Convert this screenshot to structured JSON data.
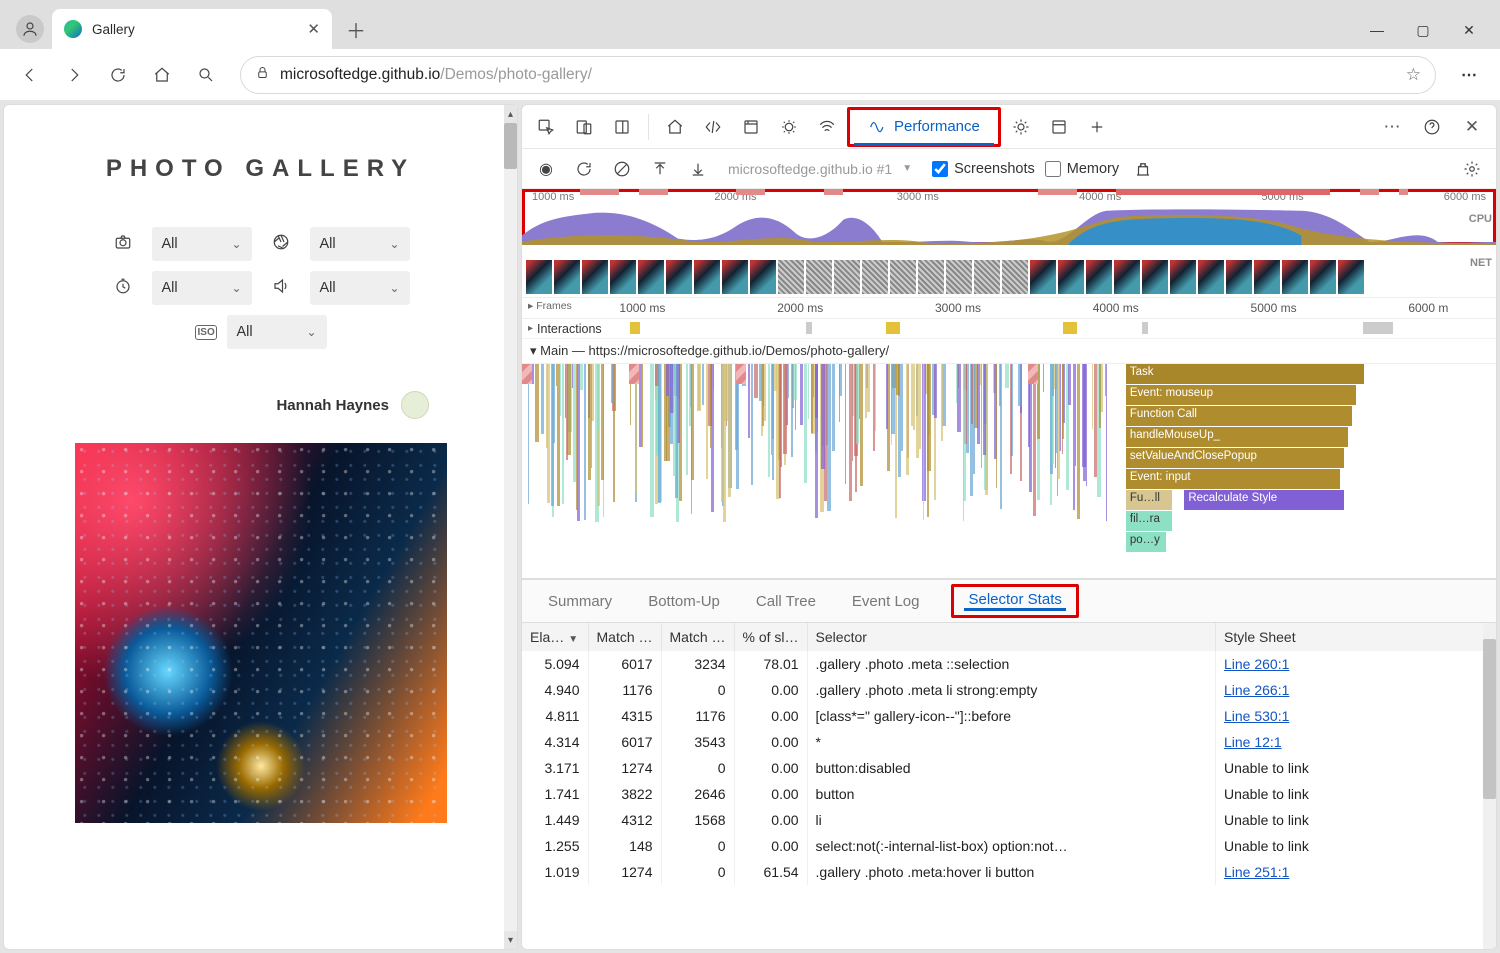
{
  "browser": {
    "tab_title": "Gallery",
    "url_domain": "microsoftedge.github.io",
    "url_path": "/Demos/photo-gallery/"
  },
  "page": {
    "title": "PHOTO GALLERY",
    "filters": {
      "camera": "All",
      "refresh": "All",
      "time": "All",
      "speaker": "All",
      "iso_label": "ISO",
      "iso": "All"
    },
    "user_name": "Hannah Haynes"
  },
  "devtools": {
    "active_panel": "Performance",
    "recording_label": "microsoftedge.github.io #1",
    "screenshots_label": "Screenshots",
    "screenshots_checked": true,
    "memory_label": "Memory",
    "memory_checked": false,
    "overview_ticks": [
      "1000 ms",
      "2000 ms",
      "3000 ms",
      "4000 ms",
      "5000 ms",
      "6000 ms"
    ],
    "cpu_label": "CPU",
    "net_label": "NET",
    "frames_label": "Frames",
    "ruler_ticks": [
      "1000 ms",
      "2000 ms",
      "3000 ms",
      "4000 ms",
      "5000 ms",
      "6000 m"
    ],
    "interactions_label": "Interactions",
    "main_label": "Main — https://microsoftedge.github.io/Demos/photo-gallery/",
    "flame": {
      "task": "Task",
      "mouseup": "Event: mouseup",
      "fncall": "Function Call",
      "handle": "handleMouseUp_",
      "setval": "setValueAndClosePopup",
      "input": "Event: input",
      "full": "Fu…ll",
      "recalc": "Recalculate Style",
      "fil": "fil…ra",
      "po": "po…y"
    },
    "detail_tabs": [
      "Summary",
      "Bottom-Up",
      "Call Tree",
      "Event Log",
      "Selector Stats"
    ],
    "active_detail": "Selector Stats",
    "table": {
      "columns": [
        "Ela…",
        "Match …",
        "Match …",
        "% of sl…",
        "Selector",
        "Style Sheet"
      ],
      "rows": [
        {
          "elapsed": "5.094",
          "attempt": "6017",
          "count": "3234",
          "pct": "78.01",
          "selector": ".gallery .photo .meta ::selection",
          "sheet": "Line 260:1",
          "link": true
        },
        {
          "elapsed": "4.940",
          "attempt": "1176",
          "count": "0",
          "pct": "0.00",
          "selector": ".gallery .photo .meta li strong:empty",
          "sheet": "Line 266:1",
          "link": true
        },
        {
          "elapsed": "4.811",
          "attempt": "4315",
          "count": "1176",
          "pct": "0.00",
          "selector": "[class*=\" gallery-icon--\"]::before",
          "sheet": "Line 530:1",
          "link": true
        },
        {
          "elapsed": "4.314",
          "attempt": "6017",
          "count": "3543",
          "pct": "0.00",
          "selector": "*",
          "sheet": "Line 12:1",
          "link": true
        },
        {
          "elapsed": "3.171",
          "attempt": "1274",
          "count": "0",
          "pct": "0.00",
          "selector": "button:disabled",
          "sheet": "Unable to link",
          "link": false
        },
        {
          "elapsed": "1.741",
          "attempt": "3822",
          "count": "2646",
          "pct": "0.00",
          "selector": "button",
          "sheet": "Unable to link",
          "link": false
        },
        {
          "elapsed": "1.449",
          "attempt": "4312",
          "count": "1568",
          "pct": "0.00",
          "selector": "li",
          "sheet": "Unable to link",
          "link": false
        },
        {
          "elapsed": "1.255",
          "attempt": "148",
          "count": "0",
          "pct": "0.00",
          "selector": "select:not(:-internal-list-box) option:not…",
          "sheet": "Unable to link",
          "link": false
        },
        {
          "elapsed": "1.019",
          "attempt": "1274",
          "count": "0",
          "pct": "61.54",
          "selector": ".gallery .photo .meta:hover li button",
          "sheet": "Line 251:1",
          "link": true
        }
      ]
    }
  }
}
